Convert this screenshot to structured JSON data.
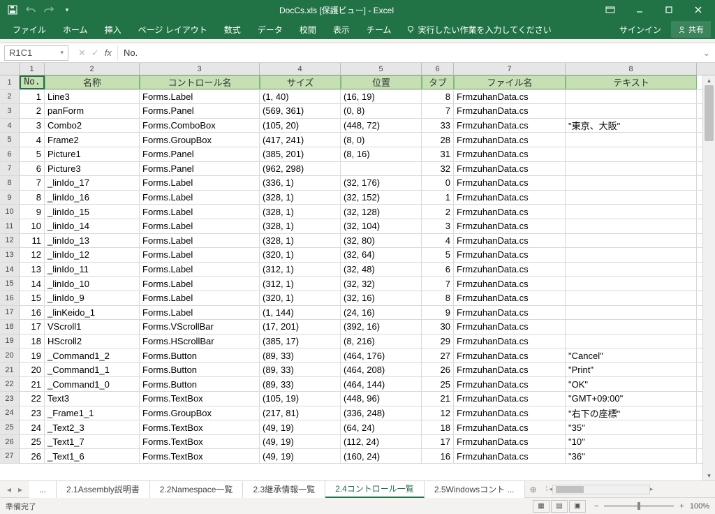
{
  "title": "DocCs.xls  [保護ビュー] - Excel",
  "qat": {
    "save": "save-icon",
    "undo": "undo-icon",
    "redo": "redo-icon"
  },
  "ribbon_tabs": [
    "ファイル",
    "ホーム",
    "挿入",
    "ページ レイアウト",
    "数式",
    "データ",
    "校閲",
    "表示",
    "チーム"
  ],
  "tell_me": "実行したい作業を入力してください",
  "signin": "サインイン",
  "share": "共有",
  "namebox": "R1C1",
  "formula": "No.",
  "col_numbers": [
    "1",
    "2",
    "3",
    "4",
    "5",
    "6",
    "7",
    "8"
  ],
  "headers": [
    "No.",
    "名称",
    "コントロール名",
    "サイズ",
    "位置",
    "タブ",
    "ファイル名",
    "テキスト"
  ],
  "rows": [
    {
      "n": "1",
      "name": "Line3",
      "ctrl": "Forms.Label",
      "size": "(1, 40)",
      "pos": "(16, 19)",
      "tab": "8",
      "file": "FrmzuhanData.cs",
      "text": ""
    },
    {
      "n": "2",
      "name": "panForm",
      "ctrl": "Forms.Panel",
      "size": "(569, 361)",
      "pos": "(0, 8)",
      "tab": "7",
      "file": "FrmzuhanData.cs",
      "text": ""
    },
    {
      "n": "3",
      "name": "Combo2",
      "ctrl": "Forms.ComboBox",
      "size": "(105, 20)",
      "pos": "(448, 72)",
      "tab": "33",
      "file": "FrmzuhanData.cs",
      "text": "\"東京、大阪\""
    },
    {
      "n": "4",
      "name": "Frame2",
      "ctrl": "Forms.GroupBox",
      "size": "(417, 241)",
      "pos": "(8, 0)",
      "tab": "28",
      "file": "FrmzuhanData.cs",
      "text": ""
    },
    {
      "n": "5",
      "name": "Picture1",
      "ctrl": "Forms.Panel",
      "size": "(385, 201)",
      "pos": "(8, 16)",
      "tab": "31",
      "file": "FrmzuhanData.cs",
      "text": ""
    },
    {
      "n": "6",
      "name": "Picture3",
      "ctrl": "Forms.Panel",
      "size": "(962, 298)",
      "pos": "",
      "tab": "32",
      "file": "FrmzuhanData.cs",
      "text": ""
    },
    {
      "n": "7",
      "name": "_linIdo_17",
      "ctrl": "Forms.Label",
      "size": "(336, 1)",
      "pos": "(32, 176)",
      "tab": "0",
      "file": "FrmzuhanData.cs",
      "text": ""
    },
    {
      "n": "8",
      "name": "_linIdo_16",
      "ctrl": "Forms.Label",
      "size": "(328, 1)",
      "pos": "(32, 152)",
      "tab": "1",
      "file": "FrmzuhanData.cs",
      "text": ""
    },
    {
      "n": "9",
      "name": "_linIdo_15",
      "ctrl": "Forms.Label",
      "size": "(328, 1)",
      "pos": "(32, 128)",
      "tab": "2",
      "file": "FrmzuhanData.cs",
      "text": ""
    },
    {
      "n": "10",
      "name": "_linIdo_14",
      "ctrl": "Forms.Label",
      "size": "(328, 1)",
      "pos": "(32, 104)",
      "tab": "3",
      "file": "FrmzuhanData.cs",
      "text": ""
    },
    {
      "n": "11",
      "name": "_linIdo_13",
      "ctrl": "Forms.Label",
      "size": "(328, 1)",
      "pos": "(32, 80)",
      "tab": "4",
      "file": "FrmzuhanData.cs",
      "text": ""
    },
    {
      "n": "12",
      "name": "_linIdo_12",
      "ctrl": "Forms.Label",
      "size": "(320, 1)",
      "pos": "(32, 64)",
      "tab": "5",
      "file": "FrmzuhanData.cs",
      "text": ""
    },
    {
      "n": "13",
      "name": "_linIdo_11",
      "ctrl": "Forms.Label",
      "size": "(312, 1)",
      "pos": "(32, 48)",
      "tab": "6",
      "file": "FrmzuhanData.cs",
      "text": ""
    },
    {
      "n": "14",
      "name": "_linIdo_10",
      "ctrl": "Forms.Label",
      "size": "(312, 1)",
      "pos": "(32, 32)",
      "tab": "7",
      "file": "FrmzuhanData.cs",
      "text": ""
    },
    {
      "n": "15",
      "name": "_linIdo_9",
      "ctrl": "Forms.Label",
      "size": "(320, 1)",
      "pos": "(32, 16)",
      "tab": "8",
      "file": "FrmzuhanData.cs",
      "text": ""
    },
    {
      "n": "16",
      "name": "_linKeido_1",
      "ctrl": "Forms.Label",
      "size": "(1, 144)",
      "pos": "(24, 16)",
      "tab": "9",
      "file": "FrmzuhanData.cs",
      "text": ""
    },
    {
      "n": "17",
      "name": "VScroll1",
      "ctrl": "Forms.VScrollBar",
      "size": "(17, 201)",
      "pos": "(392, 16)",
      "tab": "30",
      "file": "FrmzuhanData.cs",
      "text": ""
    },
    {
      "n": "18",
      "name": "HScroll2",
      "ctrl": "Forms.HScrollBar",
      "size": "(385, 17)",
      "pos": "(8, 216)",
      "tab": "29",
      "file": "FrmzuhanData.cs",
      "text": ""
    },
    {
      "n": "19",
      "name": "_Command1_2",
      "ctrl": "Forms.Button",
      "size": "(89, 33)",
      "pos": "(464, 176)",
      "tab": "27",
      "file": "FrmzuhanData.cs",
      "text": "\"Cancel\""
    },
    {
      "n": "20",
      "name": "_Command1_1",
      "ctrl": "Forms.Button",
      "size": "(89, 33)",
      "pos": "(464, 208)",
      "tab": "26",
      "file": "FrmzuhanData.cs",
      "text": "\"Print\""
    },
    {
      "n": "21",
      "name": "_Command1_0",
      "ctrl": "Forms.Button",
      "size": "(89, 33)",
      "pos": "(464, 144)",
      "tab": "25",
      "file": "FrmzuhanData.cs",
      "text": "\"OK\""
    },
    {
      "n": "22",
      "name": "Text3",
      "ctrl": "Forms.TextBox",
      "size": "(105, 19)",
      "pos": "(448, 96)",
      "tab": "21",
      "file": "FrmzuhanData.cs",
      "text": "\"GMT+09:00\""
    },
    {
      "n": "23",
      "name": "_Frame1_1",
      "ctrl": "Forms.GroupBox",
      "size": "(217, 81)",
      "pos": "(336, 248)",
      "tab": "12",
      "file": "FrmzuhanData.cs",
      "text": "\"右下の座標\""
    },
    {
      "n": "24",
      "name": "_Text2_3",
      "ctrl": "Forms.TextBox",
      "size": "(49, 19)",
      "pos": "(64, 24)",
      "tab": "18",
      "file": "FrmzuhanData.cs",
      "text": "\"35\""
    },
    {
      "n": "25",
      "name": "_Text1_7",
      "ctrl": "Forms.TextBox",
      "size": "(49, 19)",
      "pos": "(112, 24)",
      "tab": "17",
      "file": "FrmzuhanData.cs",
      "text": "\"10\""
    },
    {
      "n": "26",
      "name": "_Text1_6",
      "ctrl": "Forms.TextBox",
      "size": "(49, 19)",
      "pos": "(160, 24)",
      "tab": "16",
      "file": "FrmzuhanData.cs",
      "text": "\"36\""
    }
  ],
  "sheet_tabs": [
    "...",
    "2.1Assembly説明書",
    "2.2Namespace一覧",
    "2.3継承情報一覧",
    "2.4コントロール一覧",
    "2.5Windowsコント ..."
  ],
  "active_sheet_tab": 4,
  "status": "準備完了",
  "zoom": "100%"
}
